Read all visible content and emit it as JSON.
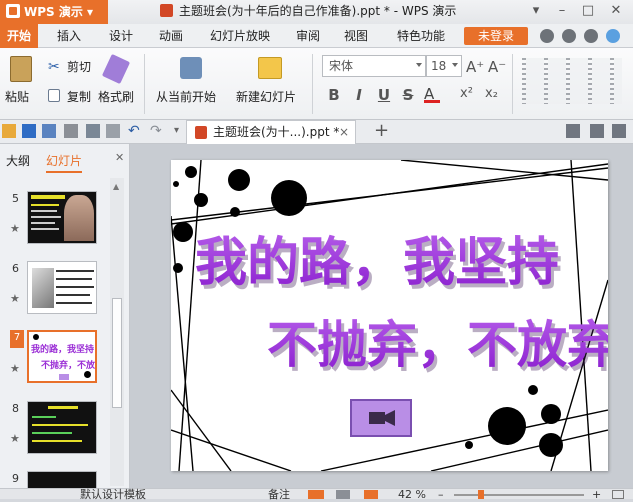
{
  "app": {
    "name": "WPS 演示",
    "title": "主题班会(为十年后的自己作准备).ppt * - WPS 演示"
  },
  "window_controls": [
    "▾",
    "–",
    "□",
    "✕"
  ],
  "menu_tabs": [
    "开始",
    "插入",
    "设计",
    "动画",
    "幻灯片放映",
    "审阅",
    "视图",
    "特色功能"
  ],
  "login": "未登录",
  "ribbon": {
    "paste": "粘贴",
    "cut": "剪切",
    "copy": "复制",
    "format_painter": "格式刷",
    "from_current": "从当前开始",
    "new_slide": "新建幻灯片",
    "font_name": "宋体",
    "font_size": "18",
    "bold": "B",
    "italic": "I",
    "underline": "U",
    "strike": "S"
  },
  "doc_tab": "主题班会(为十...).ppt *",
  "panel": {
    "tab_outline": "大纲",
    "tab_slides": "幻灯片",
    "close": "✕"
  },
  "thumbnails": [
    {
      "num": "5",
      "star": "★"
    },
    {
      "num": "6",
      "star": "★"
    },
    {
      "num": "7",
      "star": "★"
    },
    {
      "num": "8",
      "star": "★"
    },
    {
      "num": "9",
      "star": ""
    }
  ],
  "slide": {
    "line1": "我的路，我坚持",
    "line2": "不抛弃，不放弃"
  },
  "status": {
    "template": "默认设计模板",
    "notes": "备注",
    "zoom": "42 %"
  },
  "colors": {
    "accent": "#e8702a",
    "title_text": "#9b2fd6",
    "button": "#b98ee6"
  }
}
